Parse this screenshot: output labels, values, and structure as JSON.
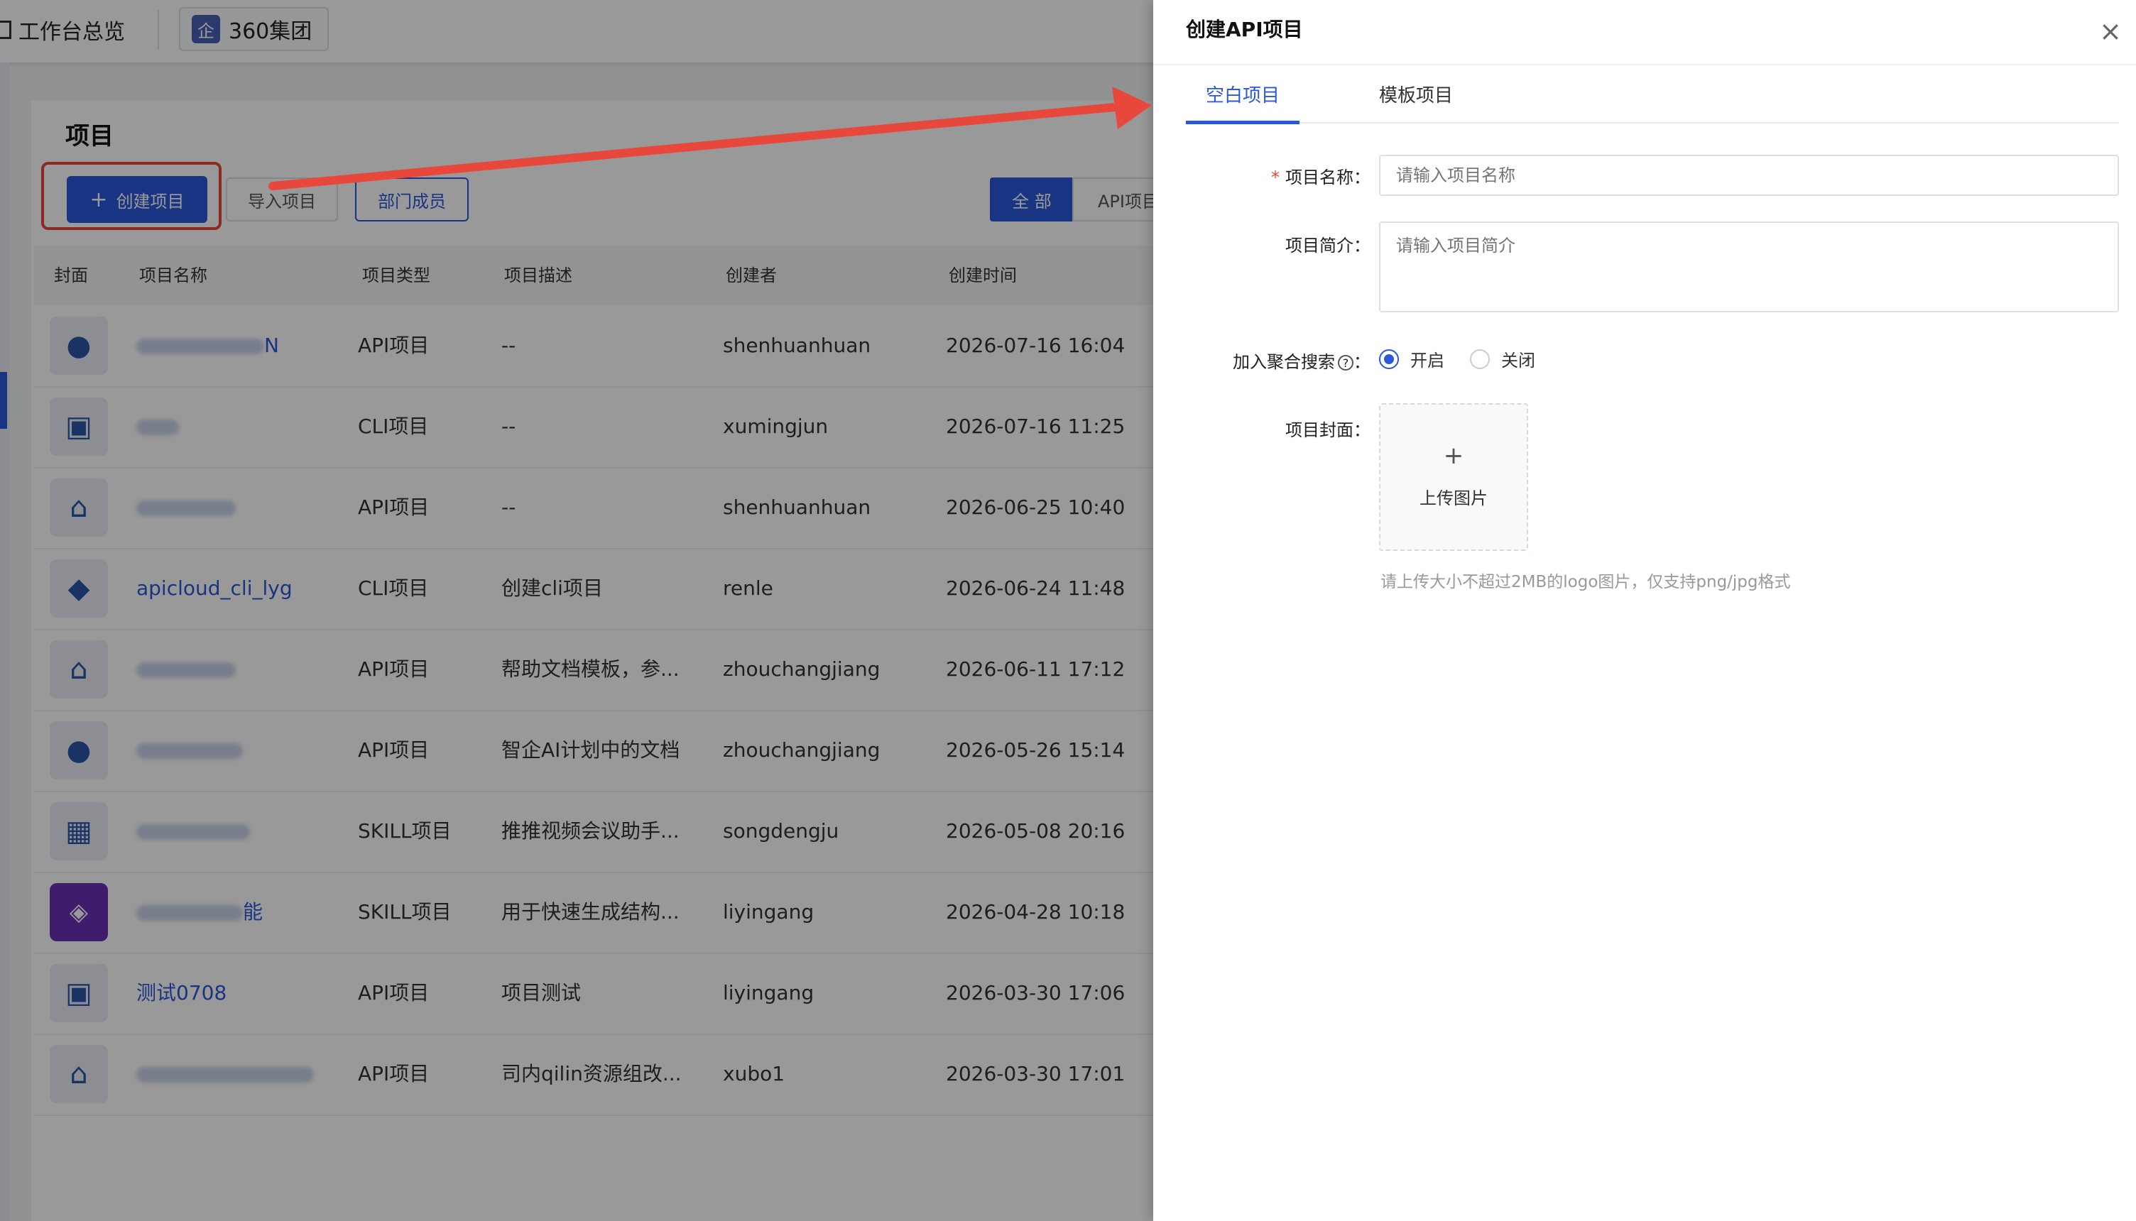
{
  "topbar": {
    "workbench_label": "工作台总览",
    "org_icon": "企",
    "org_name": "360集团"
  },
  "projects": {
    "title": "项目",
    "create_button": "创建项目",
    "import_button": "导入项目",
    "members_button": "部门成员",
    "filter_all": "全 部",
    "filter_api": "API项目",
    "columns": [
      "封面",
      "项目名称",
      "项目类型",
      "项目描述",
      "创建者",
      "创建时间"
    ],
    "rows": [
      {
        "cover_icon": "chat-bubble-icon",
        "name": "N",
        "type": "API项目",
        "desc": "--",
        "creator": "shenhuanhuan",
        "created": "2026-07-16 16:04"
      },
      {
        "cover_icon": "building-icon",
        "name": "",
        "type": "CLI项目",
        "desc": "--",
        "creator": "xumingjun",
        "created": "2026-07-16 11:25"
      },
      {
        "cover_icon": "house-icon",
        "name": "",
        "type": "API项目",
        "desc": "--",
        "creator": "shenhuanhuan",
        "created": "2026-06-25 10:40"
      },
      {
        "cover_icon": "shield-icon",
        "name": "apicloud_cli_lyg",
        "type": "CLI项目",
        "desc": "创建cli项目",
        "creator": "renle",
        "created": "2026-06-24 11:48"
      },
      {
        "cover_icon": "house-icon",
        "name": "",
        "type": "API项目",
        "desc": "帮助文档模板，参...",
        "creator": "zhouchangjiang",
        "created": "2026-06-11 17:12"
      },
      {
        "cover_icon": "chat-bubble-icon",
        "name": "",
        "type": "API项目",
        "desc": "智企AI计划中的文档",
        "creator": "zhouchangjiang",
        "created": "2026-05-26 15:14"
      },
      {
        "cover_icon": "robot-icon",
        "name": "",
        "type": "SKILL项目",
        "desc": "推推视频会议助手...",
        "creator": "songdengju",
        "created": "2026-05-08 20:16"
      },
      {
        "cover_icon": "cube-icon",
        "name": "能",
        "type": "SKILL项目",
        "desc": "用于快速生成结构...",
        "creator": "liyingang",
        "created": "2026-04-28 10:18"
      },
      {
        "cover_icon": "building-icon",
        "name": "测试0708",
        "type": "API项目",
        "desc": "项目测试",
        "creator": "liyingang",
        "created": "2026-03-30 17:06"
      },
      {
        "cover_icon": "house-icon",
        "name": "",
        "type": "API项目",
        "desc": "司内qilin资源组改...",
        "creator": "xubo1",
        "created": "2026-03-30 17:01"
      }
    ]
  },
  "drawer": {
    "title": "创建API项目",
    "tabs": [
      "空白项目",
      "模板项目"
    ],
    "active_tab": "空白项目",
    "required_mark": "*",
    "name_label": "项目名称：",
    "name_placeholder": "请输入项目名称",
    "desc_label": "项目简介：",
    "desc_placeholder": "请输入项目简介",
    "search_label": "加入聚合搜索",
    "search_label_suffix": "：",
    "search_help_icon": "?",
    "radio_on": "开启",
    "radio_off": "关闭",
    "search_enabled": true,
    "cover_label": "项目封面：",
    "upload_plus": "+",
    "upload_label": "上传图片",
    "upload_hint": "请上传大小不超过2MB的logo图片，仅支持png/jpg格式"
  },
  "colors": {
    "primary": "#2b57d9",
    "annotation": "#e8483b"
  }
}
